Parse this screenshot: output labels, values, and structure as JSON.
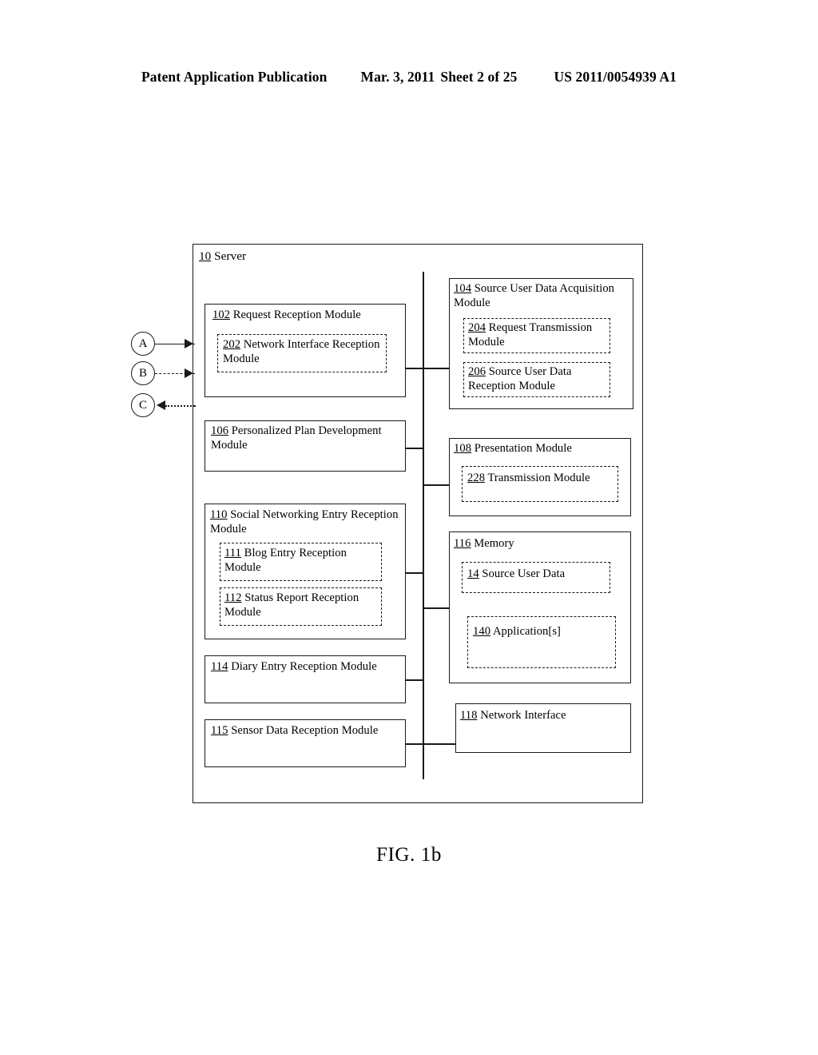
{
  "header": {
    "publication": "Patent Application Publication",
    "date": "Mar. 3, 2011",
    "sheet": "Sheet 2 of 25",
    "patent_number": "US 2011/0054939 A1"
  },
  "figure": {
    "caption": "FIG. 1b"
  },
  "diagram": {
    "container": {
      "ref": "10",
      "label": "Server"
    },
    "connectors": [
      {
        "name": "A",
        "line_style": "solid",
        "direction": "right"
      },
      {
        "name": "B",
        "line_style": "dashed",
        "direction": "right"
      },
      {
        "name": "C",
        "line_style": "dotted",
        "direction": "left"
      }
    ],
    "blocks": {
      "b102": {
        "ref": "102",
        "label": "Request Reception Module"
      },
      "b202": {
        "ref": "202",
        "label": "Network Interface Reception Module"
      },
      "b106": {
        "ref": "106",
        "label": "Personalized Plan Development Module"
      },
      "b110": {
        "ref": "110",
        "label": "Social Networking Entry Reception Module"
      },
      "b111": {
        "ref": "111",
        "label": "Blog Entry Reception Module"
      },
      "b112": {
        "ref": "112",
        "label": "Status Report Reception Module"
      },
      "b114": {
        "ref": "114",
        "label": "Diary Entry Reception Module"
      },
      "b115": {
        "ref": "115",
        "label": "Sensor Data Reception Module"
      },
      "b104": {
        "ref": "104",
        "label": "Source User Data Acquisition Module"
      },
      "b204": {
        "ref": "204",
        "label": "Request Transmission Module"
      },
      "b206": {
        "ref": "206",
        "label": "Source User Data Reception Module"
      },
      "b108": {
        "ref": "108",
        "label": "Presentation Module"
      },
      "b228": {
        "ref": "228",
        "label": "Transmission Module"
      },
      "b116": {
        "ref": "116",
        "label": "Memory"
      },
      "b14": {
        "ref": "14",
        "label": "Source User Data"
      },
      "b140": {
        "ref": "140",
        "label": "Application[s]"
      },
      "b118": {
        "ref": "118",
        "label": "Network Interface"
      }
    }
  }
}
